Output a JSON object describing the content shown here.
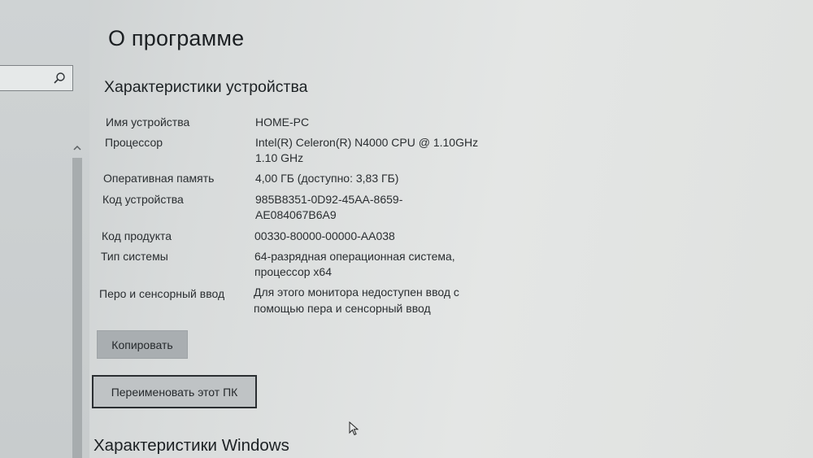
{
  "window": {
    "title": "О программе"
  },
  "sidebar": {
    "search_icon": "search-icon",
    "scroll_up_icon": "chevron-up-icon"
  },
  "device_specs": {
    "title": "Характеристики устройства",
    "rows": [
      {
        "label": "Имя устройства",
        "value_lines": [
          "HOME-PC"
        ]
      },
      {
        "label": "Процессор",
        "value_lines": [
          "Intel(R) Celeron(R) N4000 CPU @ 1.10GHz",
          "1.10 GHz"
        ]
      },
      {
        "label": "Оперативная память",
        "value_lines": [
          "4,00 ГБ (доступно: 3,83 ГБ)"
        ]
      },
      {
        "label": "Код устройства",
        "value_lines": [
          "985B8351-0D92-45AA-8659-",
          "AE084067B6A9"
        ]
      },
      {
        "label": "Код продукта",
        "value_lines": [
          "00330-80000-00000-AA038"
        ]
      },
      {
        "label": "Тип системы",
        "value_lines": [
          "64-разрядная операционная система,",
          "процессор x64"
        ]
      },
      {
        "label": "Перо и сенсорный ввод",
        "value_lines": [
          "Для этого монитора недоступен ввод с",
          "помощью пера и сенсорный ввод"
        ]
      }
    ]
  },
  "buttons": {
    "copy_label": "Копировать",
    "rename_label": "Переименовать этот ПК"
  },
  "windows_specs": {
    "title": "Характеристики Windows"
  }
}
